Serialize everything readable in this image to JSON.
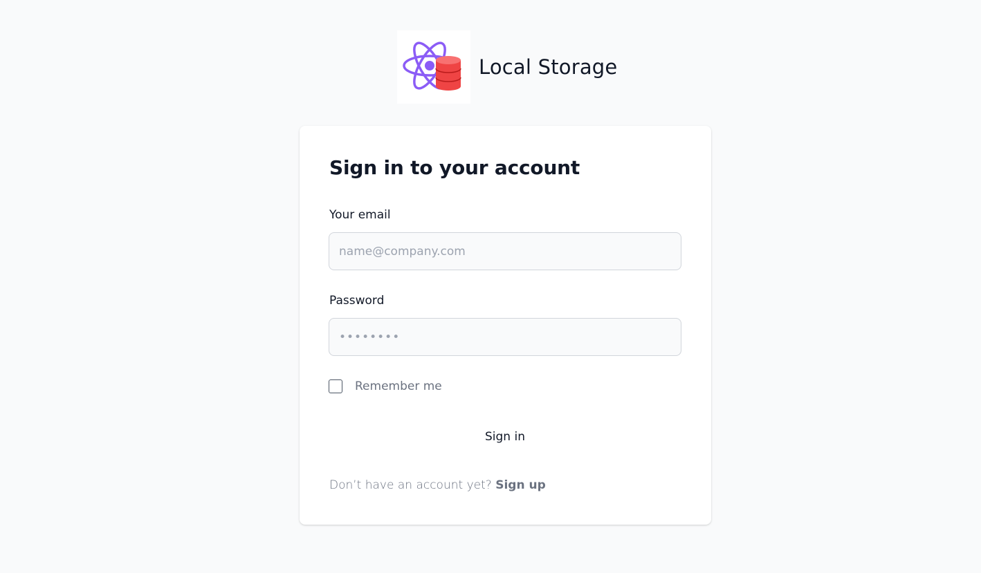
{
  "brand": {
    "name": "Local Storage",
    "logo_icon": "react-database-icon",
    "colors": {
      "atom": "#8b5cf6",
      "database": "#ef4444"
    }
  },
  "form": {
    "title": "Sign in to your account",
    "email": {
      "label": "Your email",
      "placeholder": "name@company.com",
      "value": ""
    },
    "password": {
      "label": "Password",
      "placeholder": "••••••••",
      "value": ""
    },
    "remember": {
      "label": "Remember me",
      "checked": false
    },
    "submit_label": "Sign in",
    "footer": {
      "prompt": "Don’t have an account yet?",
      "link_label": "Sign up"
    }
  }
}
